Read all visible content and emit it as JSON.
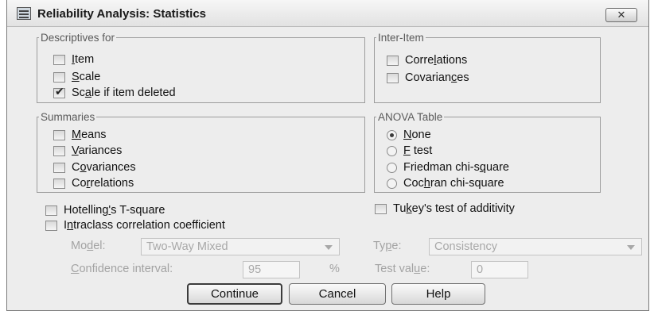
{
  "window": {
    "title": "Reliability Analysis: Statistics",
    "close_glyph": "✕"
  },
  "descriptives": {
    "legend": "Descriptives for",
    "items": [
      {
        "pre": "",
        "u": "I",
        "post": "tem",
        "checked": false
      },
      {
        "pre": "",
        "u": "S",
        "post": "cale",
        "checked": false
      },
      {
        "pre": "Sc",
        "u": "a",
        "post": "le if item deleted",
        "checked": true
      }
    ]
  },
  "inter_item": {
    "legend": "Inter-Item",
    "items": [
      {
        "pre": "Corre",
        "u": "l",
        "post": "ations",
        "checked": false
      },
      {
        "pre": "Covarian",
        "u": "c",
        "post": "es",
        "checked": false
      }
    ]
  },
  "summaries": {
    "legend": "Summaries",
    "items": [
      {
        "pre": "",
        "u": "M",
        "post": "eans",
        "checked": false
      },
      {
        "pre": "",
        "u": "V",
        "post": "ariances",
        "checked": false
      },
      {
        "pre": "C",
        "u": "o",
        "post": "variances",
        "checked": false
      },
      {
        "pre": "Co",
        "u": "r",
        "post": "relations",
        "checked": false
      }
    ]
  },
  "anova": {
    "legend": "ANOVA Table",
    "options": [
      {
        "pre": "",
        "u": "N",
        "post": "one",
        "selected": true
      },
      {
        "pre": "",
        "u": "F",
        "post": " test",
        "selected": false
      },
      {
        "pre": "Friedman chi-s",
        "u": "q",
        "post": "uare",
        "selected": false
      },
      {
        "pre": "Coc",
        "u": "h",
        "post": "ran chi-square",
        "selected": false
      }
    ]
  },
  "hotelling": {
    "pre": "Hotelling",
    "u": "'",
    "post": "s T-square",
    "checked": false
  },
  "tukey": {
    "pre": "Tu",
    "u": "k",
    "post": "ey's test of additivity",
    "checked": false
  },
  "intraclass": {
    "pre": "I",
    "u": "n",
    "post": "traclass correlation coefficient",
    "checked": false
  },
  "icc": {
    "model_label_pre": "Mo",
    "model_label_u": "d",
    "model_label_post": "el:",
    "model_value": "Two-Way Mixed",
    "type_label_pre": "Ty",
    "type_label_u": "p",
    "type_label_post": "e:",
    "type_value": "Consistency",
    "ci_label_pre": "",
    "ci_label_u": "C",
    "ci_label_post": "onfidence interval:",
    "ci_value": "95",
    "ci_unit": "%",
    "test_label_pre": "Test val",
    "test_label_u": "u",
    "test_label_post": "e:",
    "test_value": "0"
  },
  "buttons": {
    "continue": "Continue",
    "cancel": "Cancel",
    "help": "Help"
  }
}
